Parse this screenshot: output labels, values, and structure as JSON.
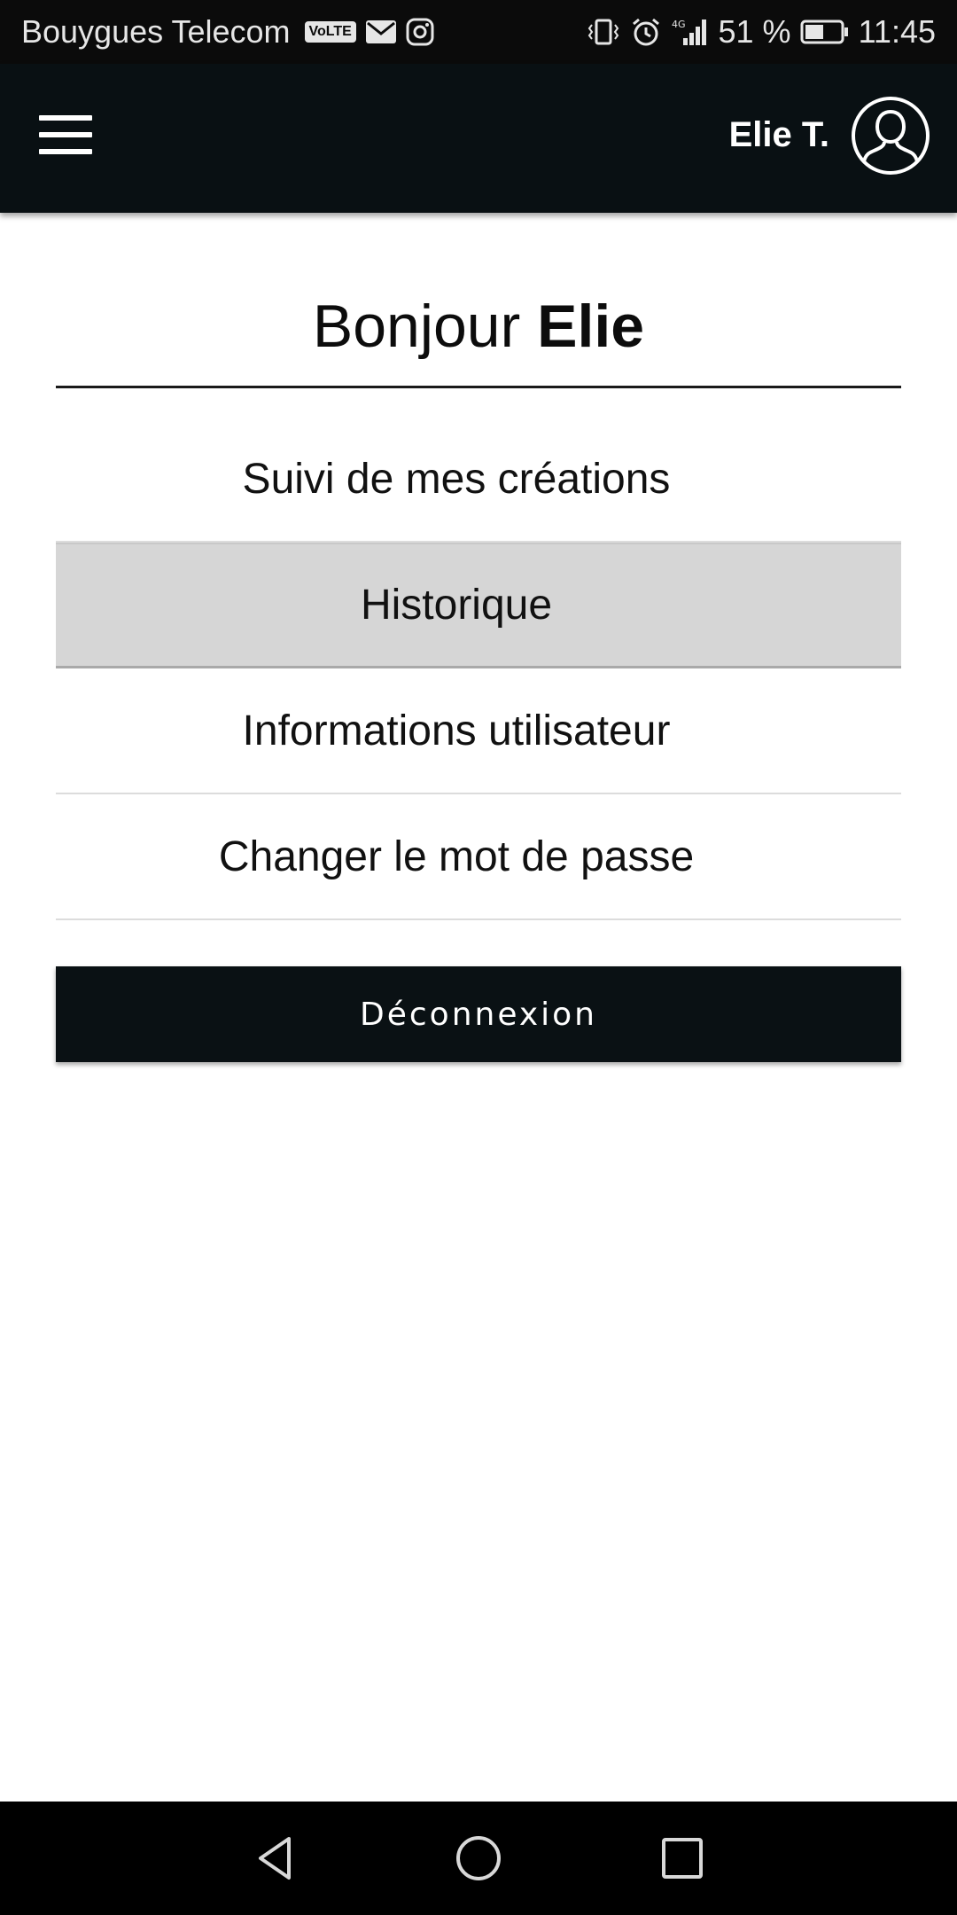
{
  "status_bar": {
    "carrier": "Bouygues Telecom",
    "volte": "VoLTE",
    "network": "4G",
    "battery": "51 %",
    "time": "11:45"
  },
  "header": {
    "user_name": "Elie T."
  },
  "greeting": {
    "prefix": "Bonjour",
    "name": "Elie"
  },
  "menu": {
    "items": [
      {
        "label": "Suivi de mes créations"
      },
      {
        "label": "Historique"
      },
      {
        "label": "Informations utilisateur"
      },
      {
        "label": "Changer le mot de passe"
      }
    ]
  },
  "logout": {
    "label": "Déconnexion"
  },
  "icons": {
    "menu": "hamburger-menu-icon",
    "avatar": "user-avatar-icon",
    "back": "back-triangle-icon",
    "home": "home-circle-icon",
    "recents": "recents-square-icon"
  },
  "colors": {
    "header_bg": "#091013",
    "active_item_bg": "#d6d6d6",
    "button_bg": "#0a1114"
  }
}
